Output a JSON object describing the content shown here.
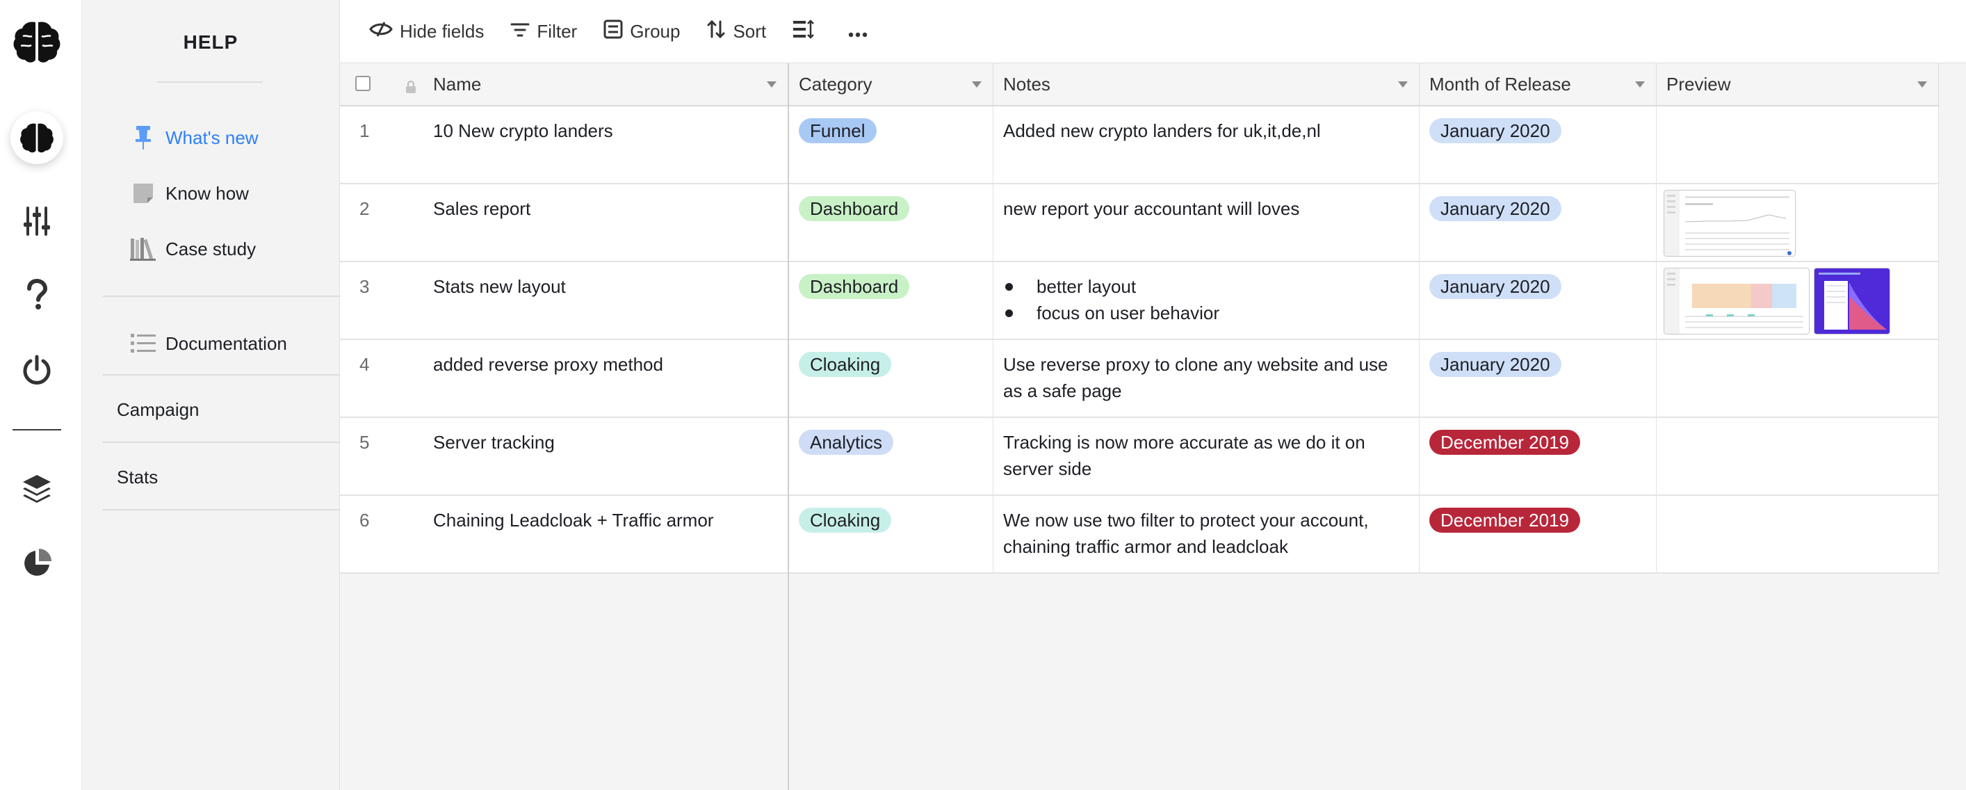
{
  "help": {
    "title": "HELP",
    "items": [
      {
        "label": "What's new",
        "icon": "pin-icon"
      },
      {
        "label": "Know how",
        "icon": "note-icon"
      },
      {
        "label": "Case study",
        "icon": "books-icon"
      },
      {
        "label": "Documentation",
        "icon": "list-icon"
      }
    ],
    "sections": [
      {
        "label": "Campaign"
      },
      {
        "label": "Stats"
      }
    ]
  },
  "toolbar": {
    "hide_fields": "Hide fields",
    "filter": "Filter",
    "group": "Group",
    "sort": "Sort"
  },
  "columns": {
    "name": "Name",
    "category": "Category",
    "notes": "Notes",
    "month": "Month of Release",
    "preview": "Preview"
  },
  "rows": [
    {
      "num": "1",
      "name": "10 New crypto landers",
      "category": "Funnel",
      "notes": "Added new crypto landers for uk,it,de,nl",
      "month": "January 2020"
    },
    {
      "num": "2",
      "name": "Sales report",
      "category": "Dashboard",
      "notes": "new report your accountant will loves",
      "month": "January 2020"
    },
    {
      "num": "3",
      "name": "Stats new layout",
      "category": "Dashboard",
      "notes_bullets": [
        "better layout",
        "focus on user behavior"
      ],
      "month": "January 2020"
    },
    {
      "num": "4",
      "name": "added reverse proxy method",
      "category": "Cloaking",
      "notes": "Use reverse proxy to clone any website and use as a safe page",
      "month": "January 2020"
    },
    {
      "num": "5",
      "name": "Server tracking",
      "category": "Analytics",
      "notes": "Tracking is now more accurate as we do it on server side",
      "month": "December 2019"
    },
    {
      "num": "6",
      "name": "Chaining Leadcloak + Traffic armor",
      "category": "Cloaking",
      "notes": "We now use two filter to protect your account, chaining traffic armor and leadcloak",
      "month": "December 2019"
    }
  ],
  "colors": {
    "accent": "#2d7ff9",
    "funnel": "#a9c9f5",
    "dashboard": "#c9f1c6",
    "cloaking": "#c7efe9",
    "analytics": "#cfdcf6",
    "month_jan": "#cfdff7",
    "month_dec": "#b8263a"
  }
}
